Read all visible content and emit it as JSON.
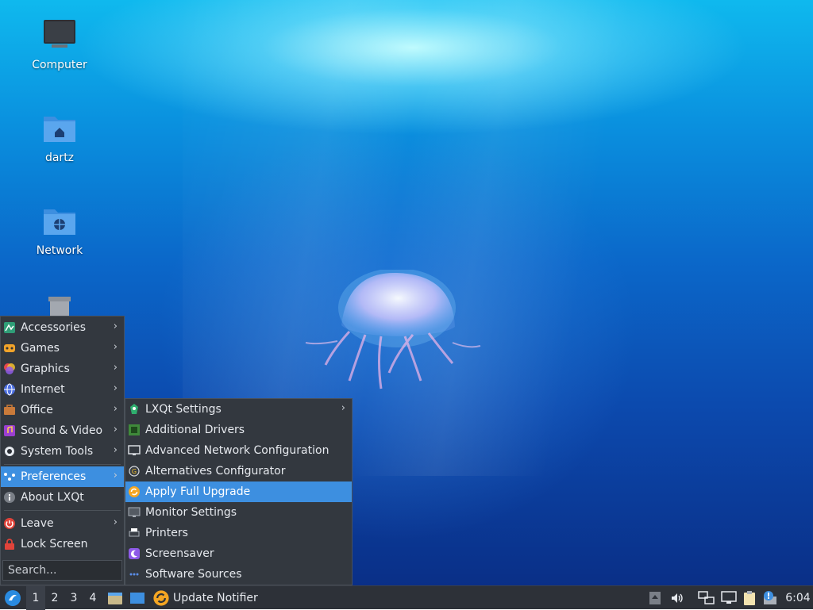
{
  "desktop": {
    "icons": [
      {
        "label": "Computer",
        "icon": "computer-icon"
      },
      {
        "label": "dartz",
        "icon": "home-folder-icon"
      },
      {
        "label": "Network",
        "icon": "network-folder-icon"
      },
      {
        "label": "",
        "icon": "trash-icon"
      }
    ]
  },
  "main_menu": {
    "items": [
      {
        "label": "Accessories",
        "icon": "accessories-icon",
        "submenu": true
      },
      {
        "label": "Games",
        "icon": "games-icon",
        "submenu": true
      },
      {
        "label": "Graphics",
        "icon": "graphics-icon",
        "submenu": true
      },
      {
        "label": "Internet",
        "icon": "internet-icon",
        "submenu": true
      },
      {
        "label": "Office",
        "icon": "office-icon",
        "submenu": true
      },
      {
        "label": "Sound & Video",
        "icon": "sound-video-icon",
        "submenu": true
      },
      {
        "label": "System Tools",
        "icon": "system-tools-icon",
        "submenu": true
      },
      {
        "label": "Preferences",
        "icon": "preferences-icon",
        "submenu": true,
        "highlighted": true
      },
      {
        "label": "About LXQt",
        "icon": "info-icon",
        "submenu": false
      },
      {
        "label": "Leave",
        "icon": "power-icon",
        "submenu": true
      },
      {
        "label": "Lock Screen",
        "icon": "lock-icon",
        "submenu": false
      }
    ],
    "search_placeholder": "Search..."
  },
  "preferences_menu": {
    "items": [
      {
        "label": "LXQt Settings",
        "icon": "lxqt-settings-icon",
        "submenu": true
      },
      {
        "label": "Additional Drivers",
        "icon": "chip-icon",
        "submenu": false
      },
      {
        "label": "Advanced Network Configuration",
        "icon": "monitor-network-icon",
        "submenu": false
      },
      {
        "label": "Alternatives Configurator",
        "icon": "alternatives-icon",
        "submenu": false
      },
      {
        "label": "Apply Full Upgrade",
        "icon": "upgrade-icon",
        "submenu": false,
        "highlighted": true
      },
      {
        "label": "Monitor Settings",
        "icon": "monitor-icon",
        "submenu": false
      },
      {
        "label": "Printers",
        "icon": "printer-icon",
        "submenu": false
      },
      {
        "label": "Screensaver",
        "icon": "screensaver-icon",
        "submenu": false
      },
      {
        "label": "Software Sources",
        "icon": "software-sources-icon",
        "submenu": false
      }
    ]
  },
  "taskbar": {
    "workspaces": [
      "1",
      "2",
      "3",
      "4"
    ],
    "active_workspace": "1",
    "task_label": "Update Notifier",
    "clock": "6:04"
  },
  "colors": {
    "menu_bg": "#33383f",
    "highlight": "#3d8fe0",
    "taskbar_bg": "#2d3138"
  }
}
